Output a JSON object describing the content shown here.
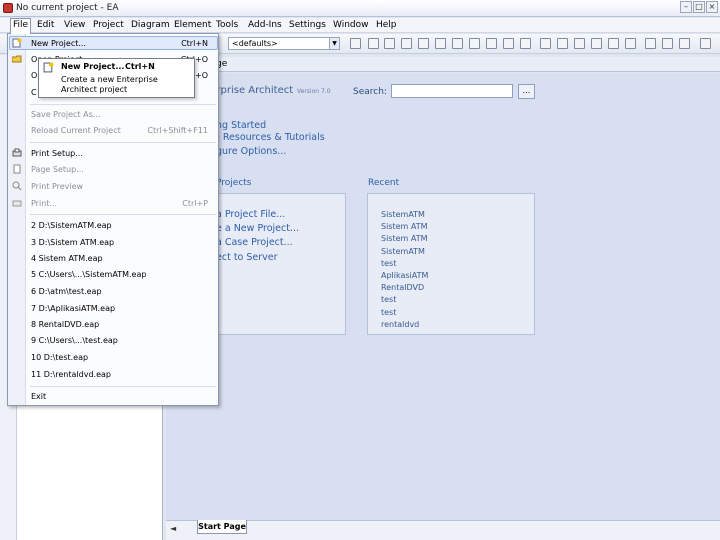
{
  "window": {
    "title": "No current project - EA"
  },
  "menubar": {
    "items": [
      "File",
      "Edit",
      "View",
      "Project",
      "Diagram",
      "Element",
      "Tools",
      "Add-Ins",
      "Settings",
      "Window",
      "Help"
    ]
  },
  "toolbar": {
    "perspective": "<defaults>"
  },
  "tab": {
    "label": "ge"
  },
  "file_menu": {
    "items": [
      {
        "label": "New Project...",
        "shortcut": "Ctrl+N",
        "enabled": true,
        "highlighted": true
      },
      {
        "label": "Open Project...",
        "shortcut": "Ctrl+O",
        "enabled": true
      },
      {
        "label": "Op",
        "shortcut": "+O",
        "enabled": true
      },
      {
        "label": "C",
        "shortcut": "",
        "enabled": true
      },
      {
        "label": "Save Project As...",
        "shortcut": "",
        "enabled": false
      },
      {
        "label": "Reload Current Project",
        "shortcut": "Ctrl+Shift+F11",
        "enabled": false
      },
      {
        "label": "Print Setup...",
        "shortcut": "",
        "enabled": true
      },
      {
        "label": "Page Setup...",
        "shortcut": "",
        "enabled": false
      },
      {
        "label": "Print Preview",
        "shortcut": "",
        "enabled": false
      },
      {
        "label": "Print...",
        "shortcut": "Ctrl+P",
        "enabled": false
      }
    ],
    "recent": [
      "2 D:\\SistemATM.eap",
      "3 D:\\Sistem ATM.eap",
      "4 Sistem ATM.eap",
      "5 C:\\Users\\...\\SistemATM.eap",
      "6 D:\\atm\\test.eap",
      "7 D:\\AplikasiATM.eap",
      "8 RentalDVD.eap",
      "9 C:\\Users\\...\\test.eap",
      "10 D:\\test.eap",
      "11 D:\\rentaldvd.eap"
    ],
    "exit": "Exit"
  },
  "submenu": {
    "label": "New Project...",
    "shortcut": "Ctrl+N",
    "description": "Create a new Enterprise Architect project"
  },
  "start_page": {
    "title": "nterprise Architect",
    "version": "Version 7.0",
    "search_label": "Search:",
    "search_value": "",
    "search_button": "...",
    "links": [
      "ng Started",
      "e Resources & Tutorials",
      "gure Options..."
    ],
    "projects_heading": "Projects",
    "project_actions": [
      "a Project File...",
      "e a New Project...",
      "a Case Project...",
      "ect to Server"
    ],
    "recent_heading": "Recent",
    "recent": [
      "SistemATM",
      "Sistem ATM",
      "Sistem ATM",
      "SistemATM",
      "test",
      "AplikasiATM",
      "RentalDVD",
      "test",
      "test",
      "rentaldvd"
    ]
  },
  "bottom_tab": {
    "label": "Start Page"
  }
}
